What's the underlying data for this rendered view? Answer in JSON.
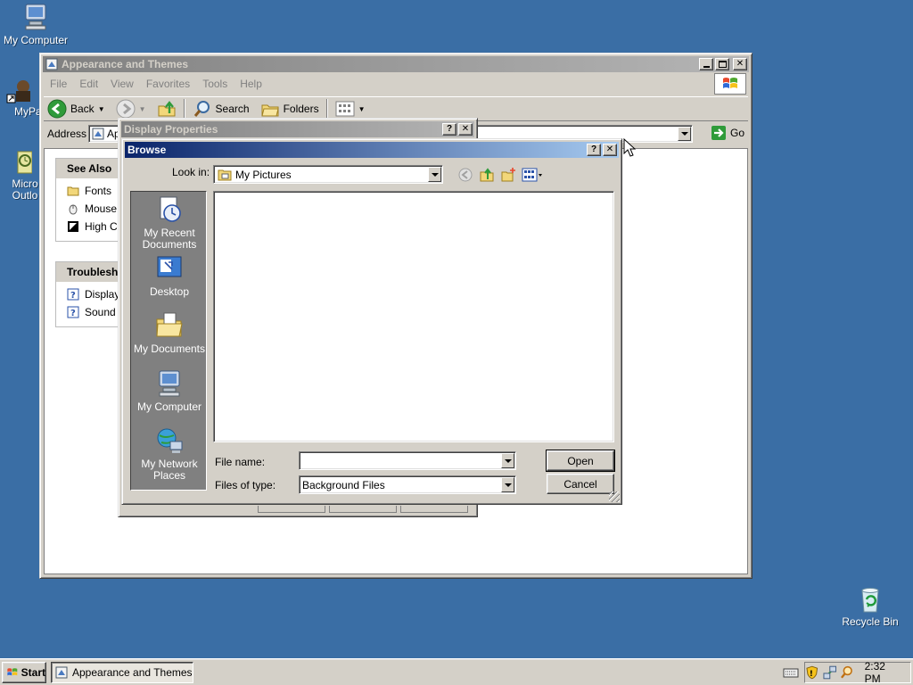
{
  "desktop": {
    "icons": [
      {
        "label": "My Computer"
      },
      {
        "label": "MyPa"
      },
      {
        "label": "Micro Outlo"
      },
      {
        "label": "Recycle Bin"
      }
    ]
  },
  "app_window": {
    "title": "Appearance and Themes",
    "menu": [
      "File",
      "Edit",
      "View",
      "Favorites",
      "Tools",
      "Help"
    ],
    "toolbar": {
      "back": "Back",
      "search": "Search",
      "folders": "Folders"
    },
    "address": {
      "label": "Address",
      "value": "Ap",
      "go": "Go"
    },
    "see_also": {
      "title": "See Also",
      "items": [
        "Fonts",
        "Mouse",
        "High Co"
      ]
    },
    "troubleshooters": {
      "title": "Troublesh",
      "items": [
        "Display",
        "Sound"
      ]
    }
  },
  "display_properties": {
    "title": "Display Properties"
  },
  "browse_dialog": {
    "title": "Browse",
    "look_in_label": "Look in:",
    "look_in_value": "My Pictures",
    "places": [
      {
        "line1": "My Recent",
        "line2": "Documents"
      },
      {
        "line1": "Desktop",
        "line2": ""
      },
      {
        "line1": "My Documents",
        "line2": ""
      },
      {
        "line1": "My Computer",
        "line2": ""
      },
      {
        "line1": "My Network",
        "line2": "Places"
      }
    ],
    "file_name_label": "File name:",
    "file_name_value": "",
    "file_type_label": "Files of type:",
    "file_type_value": "Background Files",
    "open_label": "Open",
    "cancel_label": "Cancel"
  },
  "taskbar": {
    "start_label": "Start",
    "task_label": "Appearance and Themes",
    "clock": "2:32 PM"
  },
  "colors": {
    "desktop": "#3a6ea5",
    "active_title": "#0a246a",
    "face": "#d4d0c8"
  }
}
